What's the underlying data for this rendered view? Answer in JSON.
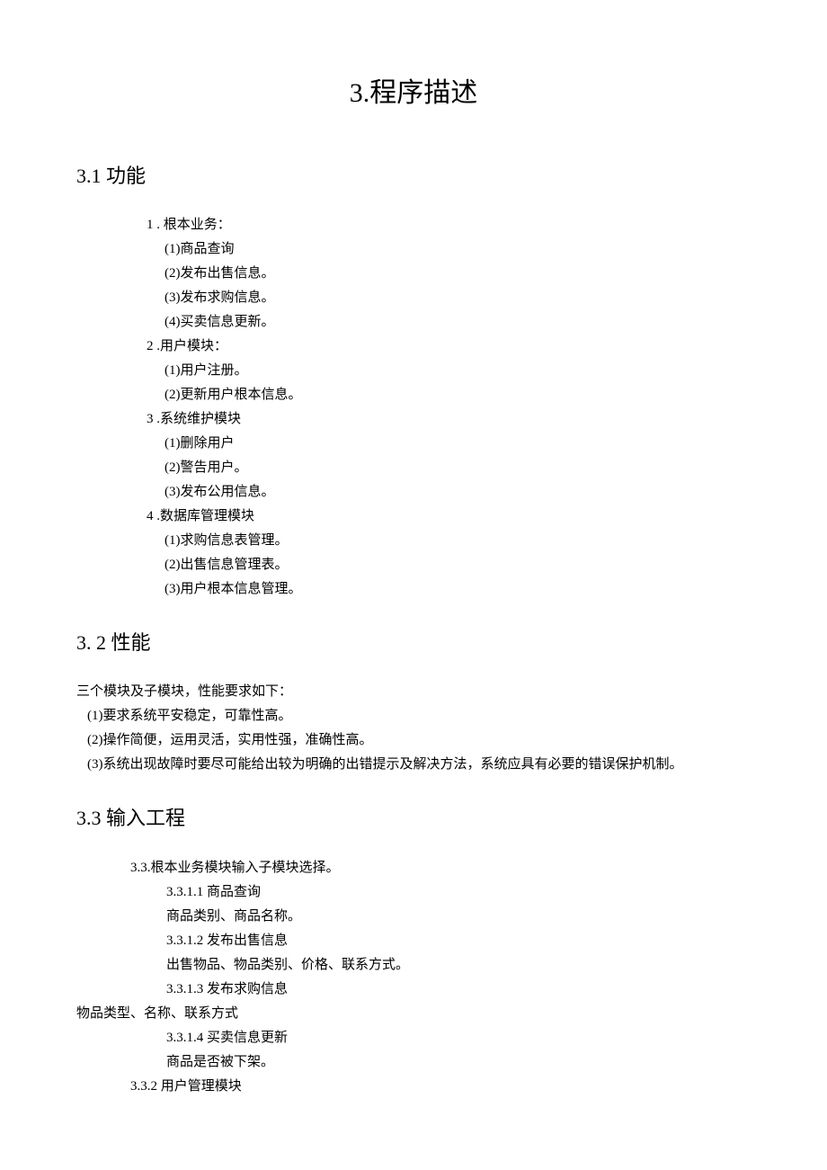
{
  "title": "3.程序描述",
  "section_3_1": {
    "heading": "3.1 功能",
    "items": [
      {
        "num": "1",
        "label": " . 根本业务：",
        "subs": [
          "(1)商品查询",
          "(2)发布出售信息。",
          "(3)发布求购信息。",
          "(4)买卖信息更新。"
        ]
      },
      {
        "num": "2",
        "label": "   .用户模块：",
        "subs": [
          "(1)用户注册。",
          "(2)更新用户根本信息。"
        ]
      },
      {
        "num": "3",
        "label": "   .系统维护模块",
        "subs": [
          "(1)删除用户",
          "(2)警告用户。",
          "(3)发布公用信息。"
        ]
      },
      {
        "num": "4",
        "label": "   .数据库管理模块",
        "subs": [
          "(1)求购信息表管理。",
          "(2)出售信息管理表。",
          "(3)用户根本信息管理。"
        ]
      }
    ]
  },
  "section_3_2": {
    "heading": "3.  2 性能",
    "intro": "三个模块及子模块，性能要求如下：",
    "items": [
      "(1)要求系统平安稳定，可靠性高。",
      "(2)操作简便，运用灵活，实用性强，准确性高。",
      "(3)系统出现故障时要尽可能给出较为明确的出错提示及解决方法，系统应具有必要的错误保护机制。"
    ]
  },
  "section_3_3": {
    "heading": "3.3 输入工程",
    "lines": [
      {
        "indent": "indent-3",
        "text": "3.3.根本业务模块输入子模块选择。"
      },
      {
        "indent": "indent-4",
        "text": "3.3.1.1 商品查询"
      },
      {
        "indent": "indent-4",
        "text": "商品类别、商品名称。"
      },
      {
        "indent": "indent-4",
        "text": "3.3.1.2 发布出售信息"
      },
      {
        "indent": "indent-4",
        "text": "出售物品、物品类别、价格、联系方式。"
      },
      {
        "indent": "indent-4",
        "text": "3.3.1.3 发布求购信息"
      },
      {
        "indent": "indent-0",
        "text": "物品类型、名称、联系方式"
      },
      {
        "indent": "indent-4",
        "text": "3.3.1.4 买卖信息更新"
      },
      {
        "indent": "indent-4",
        "text": "商品是否被下架。"
      },
      {
        "indent": "indent-3",
        "text": "3.3.2 用户管理模块"
      }
    ]
  }
}
